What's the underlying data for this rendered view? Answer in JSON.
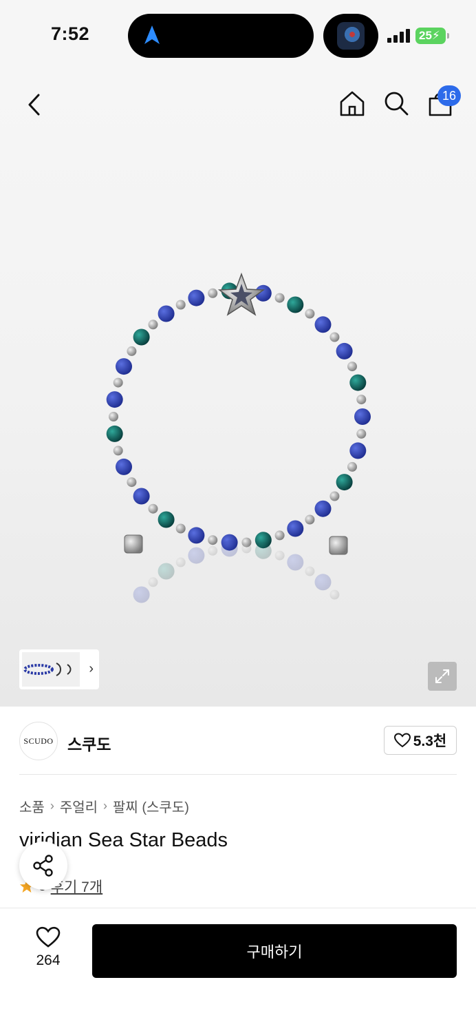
{
  "status_bar": {
    "time": "7:52",
    "battery": "25"
  },
  "header": {
    "cart_count": "16"
  },
  "brand": {
    "logo_text": "SCUDO",
    "name": "스쿠도",
    "likes": "5.3천"
  },
  "breadcrumb": [
    "소품",
    "주얼리",
    "팔찌 (스쿠도)"
  ],
  "product": {
    "title": "viridian Sea Star Beads",
    "review_score": "5",
    "review_link": "후기 7개"
  },
  "bottom_bar": {
    "wish_count": "264",
    "buy_label": "구매하기"
  },
  "colors": {
    "accent_blue": "#2d6bea",
    "battery_green": "#5bd35f",
    "star_orange": "#f5a623",
    "bead_blue": "#2a3aa6",
    "bead_teal": "#0d6f66"
  },
  "icons": [
    "navigation-arrow-icon",
    "back-arrow-icon",
    "home-icon",
    "search-icon",
    "cart-icon",
    "expand-icon",
    "heart-icon",
    "share-icon",
    "star-icon"
  ]
}
